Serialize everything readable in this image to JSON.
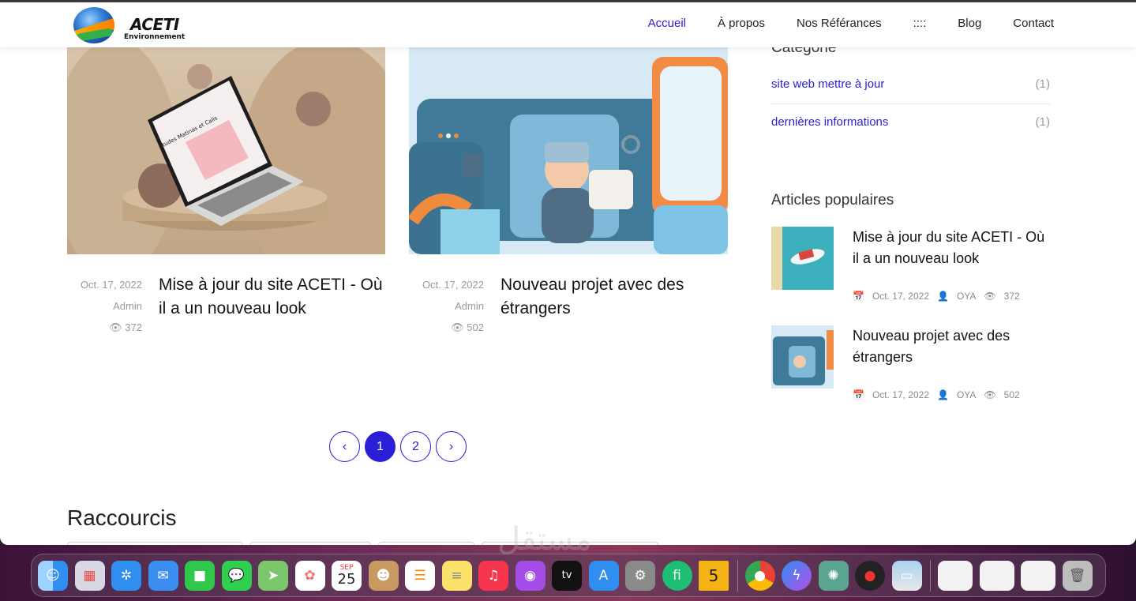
{
  "header": {
    "logo_name": "ACETI",
    "logo_sub": "Environnement",
    "nav": [
      {
        "label": "Accueil",
        "active": true
      },
      {
        "label": "À propos",
        "active": false
      },
      {
        "label": "Nos Référances",
        "active": false
      },
      {
        "label": "::::",
        "active": false
      },
      {
        "label": "Blog",
        "active": false
      },
      {
        "label": "Contact",
        "active": false
      }
    ]
  },
  "posts": [
    {
      "date": "Oct. 17, 2022",
      "author": "Admin",
      "views": "372",
      "title": "Mise à jour du site ACETI - Où il a un nouveau look"
    },
    {
      "date": "Oct. 17, 2022",
      "author": "Admin",
      "views": "502",
      "title": "Nouveau projet avec des étrangers"
    }
  ],
  "laptop_screen_text": "Etudes Matinas et Calis",
  "pagination": {
    "prev": "‹",
    "pages": [
      "1",
      "2"
    ],
    "next": "›",
    "active": "1"
  },
  "shortcuts": {
    "title": "Raccourcis"
  },
  "sidebar": {
    "categories_title": "Categorie",
    "categories": [
      {
        "label": "site web mettre à jour",
        "count": "(1)"
      },
      {
        "label": "dernières informations",
        "count": "(1)"
      }
    ],
    "popular_title": "Articles populaires",
    "popular": [
      {
        "title": "Mise à jour du site ACETI - Où il a un nouveau look",
        "date": "Oct. 17, 2022",
        "author": "OYA",
        "views": "372"
      },
      {
        "title": "Nouveau projet avec des étrangers",
        "date": "Oct. 17, 2022",
        "author": "OYA",
        "views": "502"
      }
    ]
  },
  "dock": {
    "calendar_month": "SEP",
    "calendar_day": "25",
    "tv_label": "tv",
    "badge_five": "5"
  },
  "watermark": "مستقل"
}
